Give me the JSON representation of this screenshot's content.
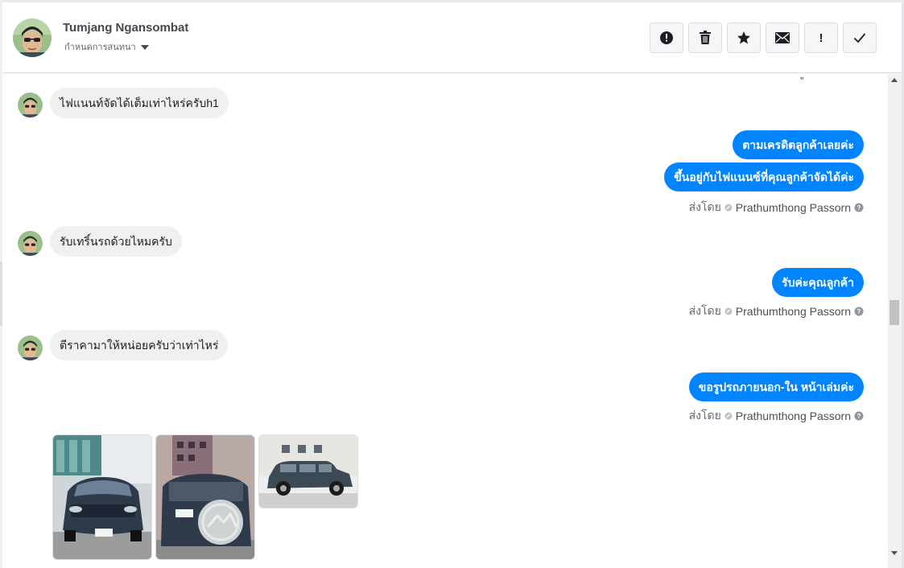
{
  "header": {
    "name": "Tumjang Ngansombat",
    "subtitle": "กำหนดการสนทนา",
    "actions": [
      {
        "icon": "spam-icon",
        "label": ""
      },
      {
        "icon": "trash-icon",
        "label": ""
      },
      {
        "icon": "star-icon",
        "label": ""
      },
      {
        "icon": "envelope-icon",
        "label": ""
      },
      {
        "icon": "exclamation-icon",
        "label": "!"
      },
      {
        "icon": "checkmark-icon",
        "label": ""
      }
    ]
  },
  "messages": {
    "incoming": [
      {
        "text": "ไฟแนนท์จัดได้เต็มเท่าไหร่ครับh1"
      },
      {
        "text": "รับเทริ์นรถด้วยไหมครับ"
      },
      {
        "text": "ตีราคามาให้หน่อยครับว่าเท่าไหร่"
      }
    ],
    "outgoing_groups": [
      {
        "bubbles": [
          "ตามเครดิตลูกค้าเลยค่ะ",
          "ขึ้นอยู่กับไฟแนนซ์ที่คุณลูกค้าจัดได้ค่ะ"
        ]
      },
      {
        "bubbles": [
          "รับค่ะคุณลูกค้า"
        ]
      },
      {
        "bubbles": [
          "ขอรูปรถภายนอก-ใน หน้าเล่มค่ะ"
        ]
      }
    ],
    "sent_by_label": "ส่งโดย",
    "sender_name": "Prathumthong Passorn"
  },
  "photos": [
    {
      "description": "car-front-photo"
    },
    {
      "description": "car-rear-photo"
    },
    {
      "description": "car-side-photo"
    }
  ],
  "colors": {
    "outgoing_bubble": "#0084ff",
    "incoming_bubble": "#f1f0f0",
    "header_border": "#dadde1",
    "button_bg": "#f5f6f7"
  }
}
